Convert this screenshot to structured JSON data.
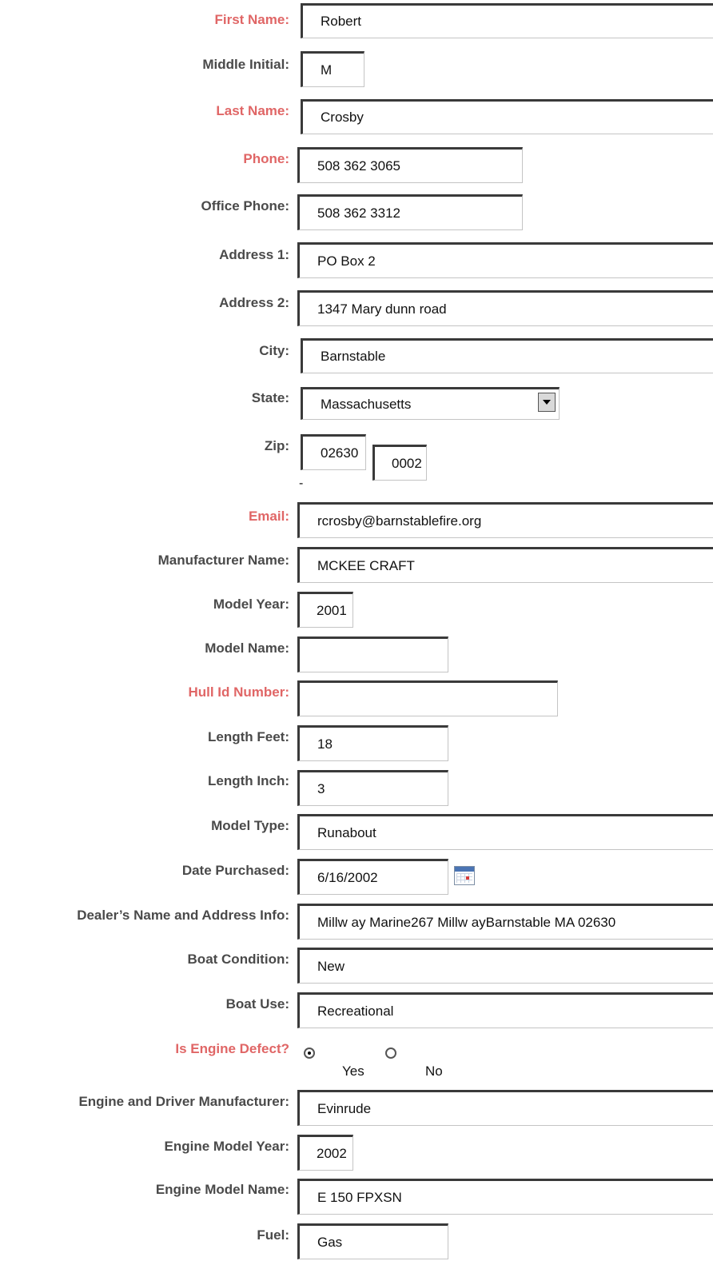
{
  "form": {
    "first_name": {
      "label": "First Name:",
      "value": "Robert"
    },
    "middle_initial": {
      "label": "Middle Initial:",
      "value": "M"
    },
    "last_name": {
      "label": "Last Name:",
      "value": "Crosby"
    },
    "phone": {
      "label": "Phone:",
      "value": "508 362 3065"
    },
    "office_phone": {
      "label": "Office Phone:",
      "value": "508 362 3312"
    },
    "address1": {
      "label": "Address 1:",
      "value": "PO Box 2"
    },
    "address2": {
      "label": "Address 2:",
      "value": "1347 Mary dunn road"
    },
    "city": {
      "label": "City:",
      "value": "Barnstable"
    },
    "state": {
      "label": "State:",
      "value": "Massachusetts"
    },
    "zip": {
      "label": "Zip:",
      "value": "02630",
      "ext": "0002",
      "separator": "-"
    },
    "email": {
      "label": "Email:",
      "value": "rcrosby@barnstablefire.org"
    },
    "manufacturer_name": {
      "label": "Manufacturer Name:",
      "value": "MCKEE CRAFT"
    },
    "model_year": {
      "label": "Model Year:",
      "value": "2001"
    },
    "model_name": {
      "label": "Model Name:",
      "value": ""
    },
    "hull_id": {
      "label": "Hull Id Number:",
      "value": ""
    },
    "length_feet": {
      "label": "Length Feet:",
      "value": "18"
    },
    "length_inch": {
      "label": "Length Inch:",
      "value": "3"
    },
    "model_type": {
      "label": "Model Type:",
      "value": "Runabout"
    },
    "date_purchased": {
      "label": "Date Purchased:",
      "value": "6/16/2002"
    },
    "dealer_info": {
      "label": "Dealer’s Name and Address Info:",
      "value": "Millw ay Marine267 Millw ayBarnstable MA 02630"
    },
    "boat_condition": {
      "label": "Boat Condition:",
      "value": "New"
    },
    "boat_use": {
      "label": "Boat Use:",
      "value": "Recreational"
    },
    "engine_defect": {
      "label": "Is Engine Defect?",
      "yes_label": "Yes",
      "no_label": "No",
      "selected": "Yes"
    },
    "engine_manufacturer": {
      "label": "Engine and Driver Manufacturer:",
      "value": "Evinrude"
    },
    "engine_model_year": {
      "label": "Engine Model Year:",
      "value": "2002"
    },
    "engine_model_name": {
      "label": "Engine Model Name:",
      "value": "E 150 FPXSN"
    },
    "fuel": {
      "label": "Fuel:",
      "value": "Gas"
    }
  },
  "colors": {
    "required_label": "#e06666",
    "label": "#4a4a4a"
  }
}
